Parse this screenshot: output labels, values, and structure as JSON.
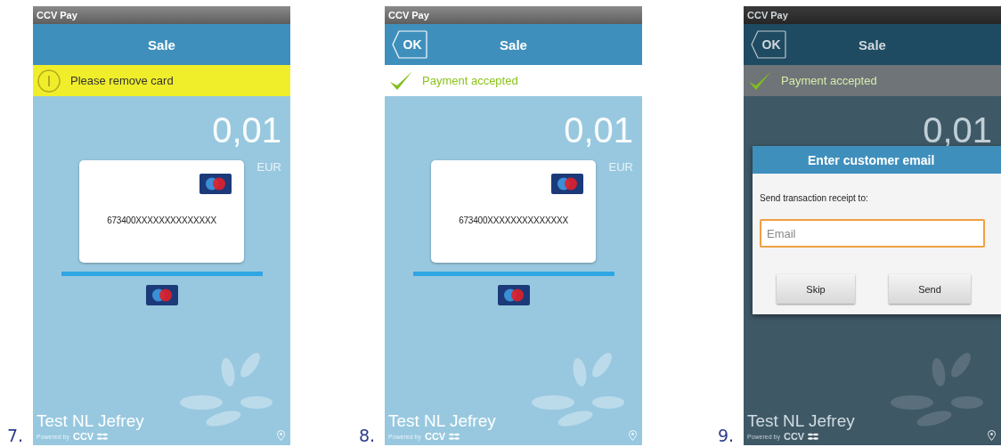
{
  "screens": [
    {
      "number": "7.",
      "status_title": "CCV Pay",
      "title": "Sale",
      "banner": {
        "kind": "warning",
        "text": "Please remove card"
      },
      "amount": "0,01",
      "currency": "EUR",
      "card": {
        "number": "673400XXXXXXXXXXXXXX"
      },
      "merchant": "Test NL Jefrey",
      "powered_by": "Powered by",
      "brand": "CCV",
      "dimmed": false
    },
    {
      "number": "8.",
      "status_title": "CCV Pay",
      "title": "Sale",
      "back_button": "OK",
      "banner": {
        "kind": "success",
        "text": "Payment accepted"
      },
      "amount": "0,01",
      "currency": "EUR",
      "card": {
        "number": "673400XXXXXXXXXXXXXX"
      },
      "merchant": "Test NL Jefrey",
      "powered_by": "Powered by",
      "brand": "CCV",
      "dimmed": false
    },
    {
      "number": "9.",
      "status_title": "CCV Pay",
      "title": "Sale",
      "back_button": "OK",
      "banner": {
        "kind": "success",
        "text": "Payment accepted"
      },
      "amount": "0,01",
      "merchant": "Test NL Jefrey",
      "powered_by": "Powered by",
      "brand": "CCV",
      "dimmed": true,
      "dialog": {
        "title": "Enter customer email",
        "message": "Send transaction receipt to:",
        "field": {
          "placeholder": "Email"
        },
        "buttons": [
          "Skip",
          "Send"
        ]
      }
    }
  ]
}
